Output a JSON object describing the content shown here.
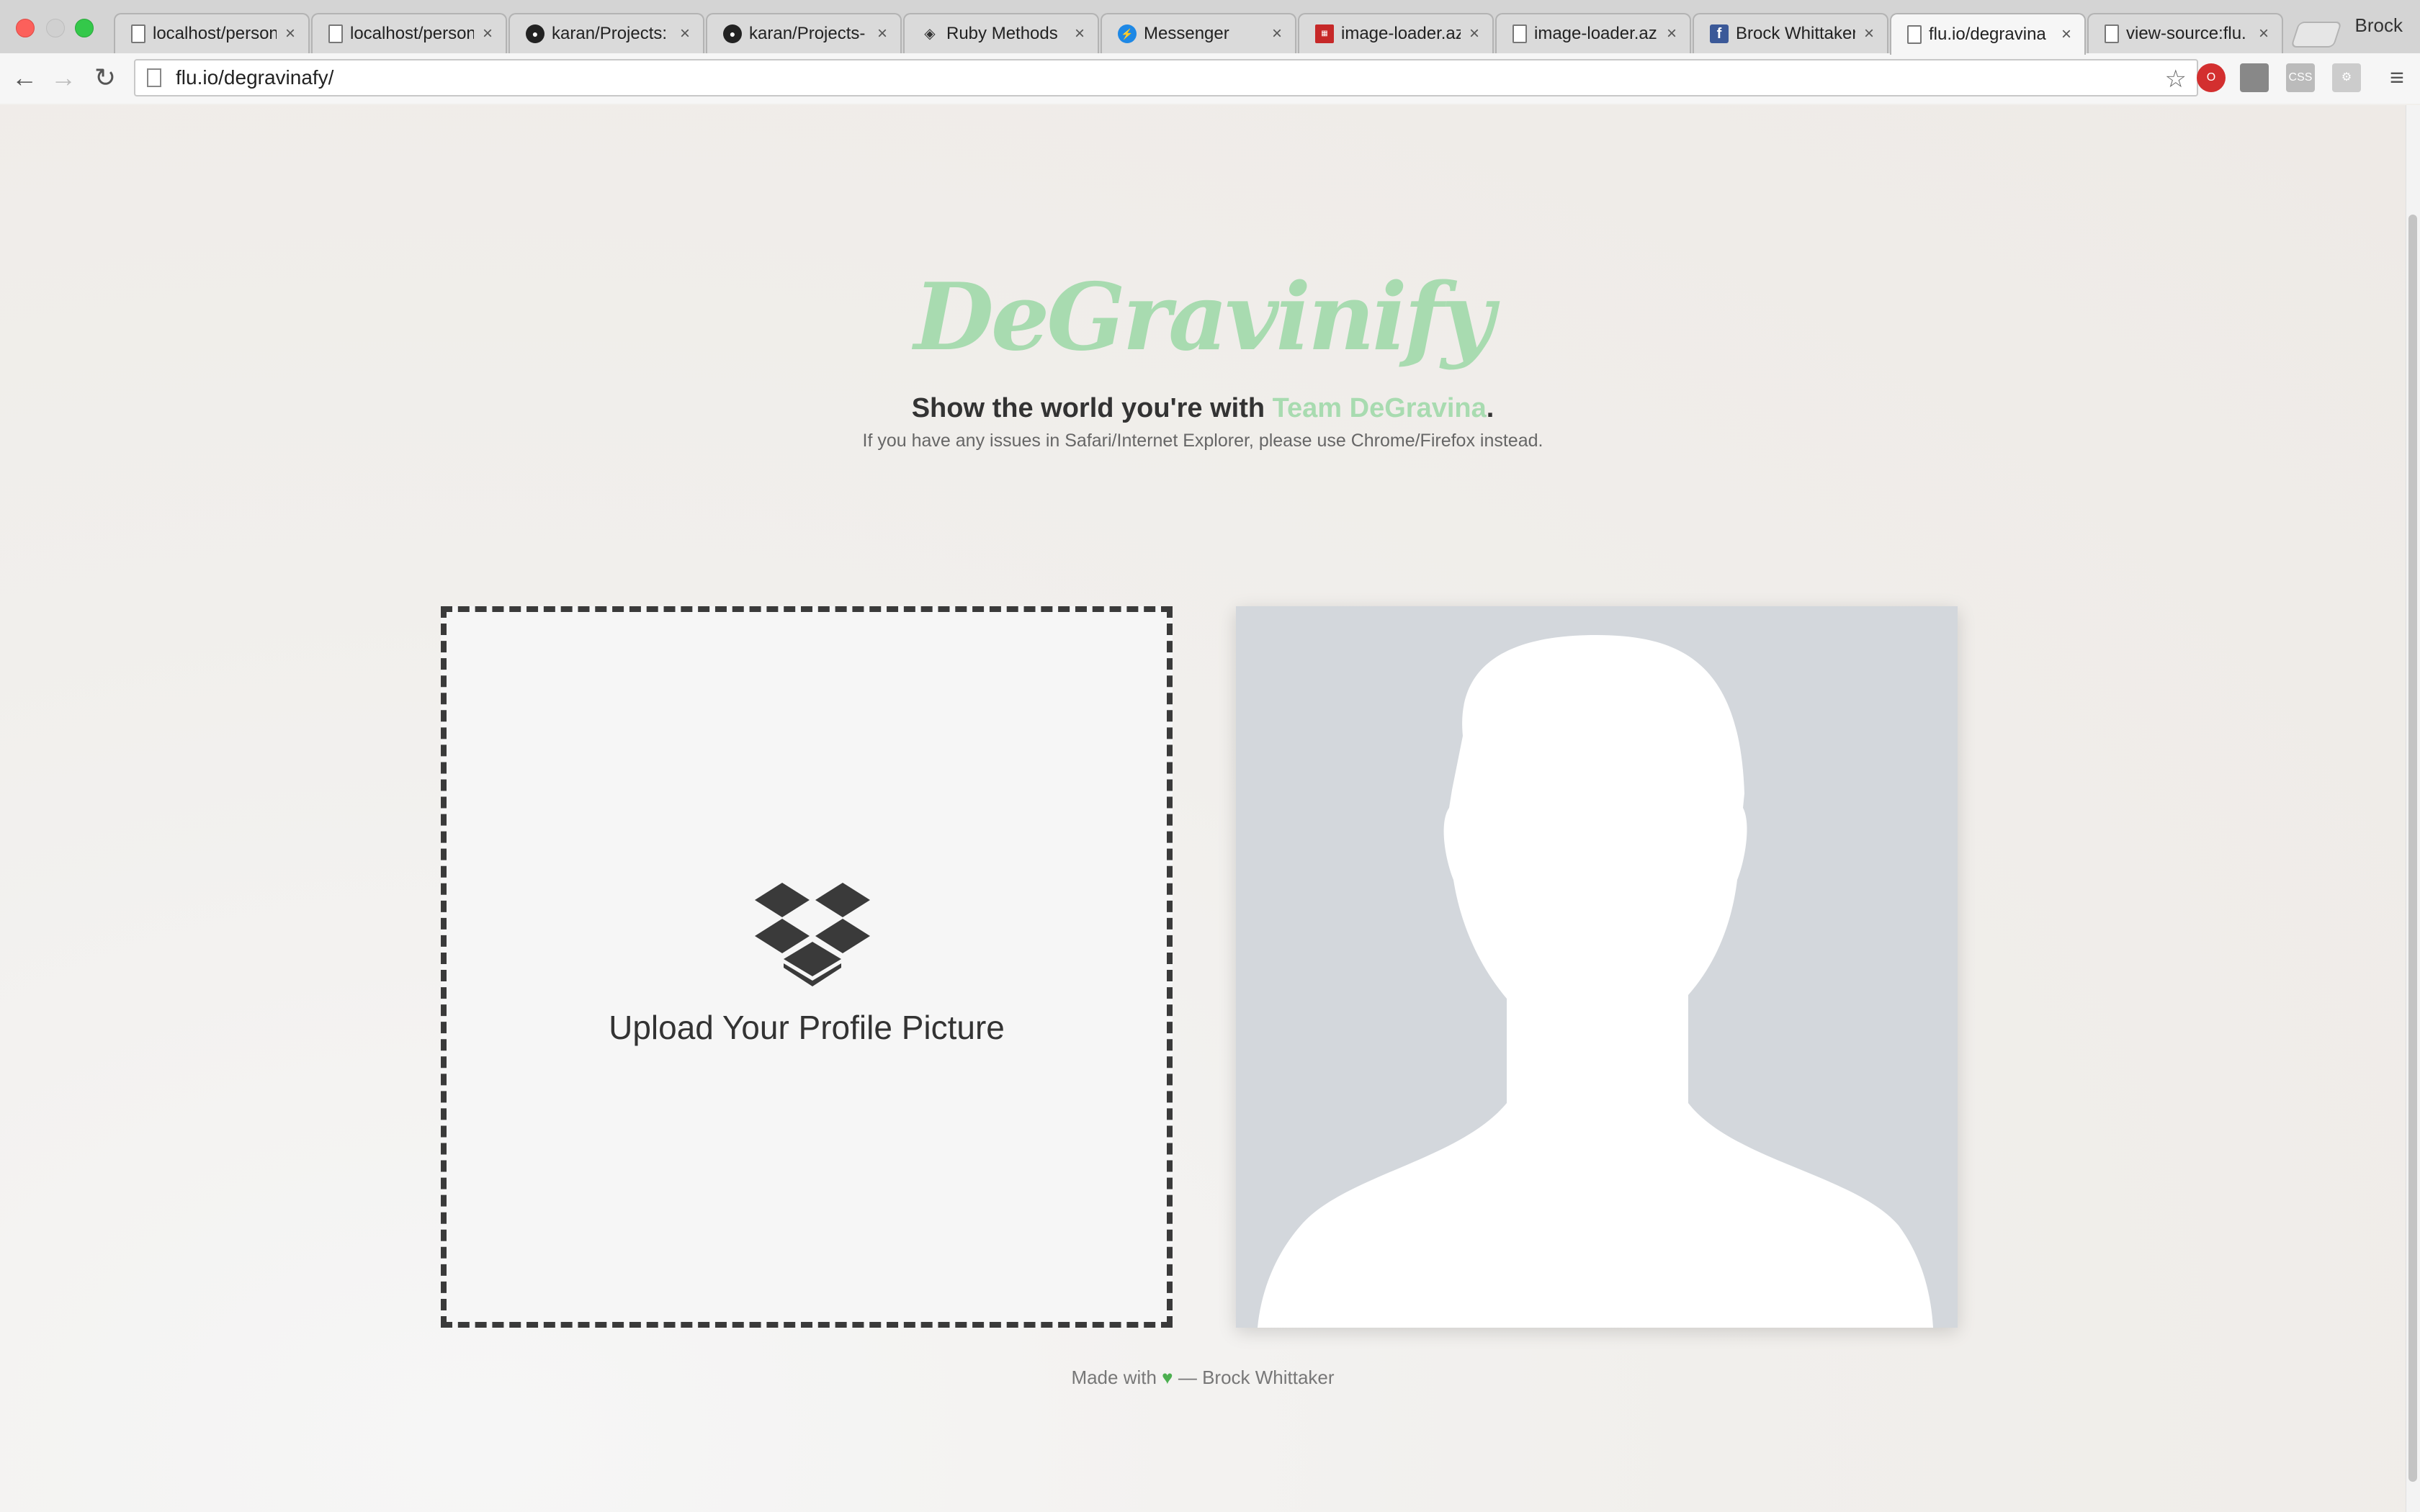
{
  "browser": {
    "tabs": [
      {
        "title": "localhost/person",
        "favicon": "page-icon"
      },
      {
        "title": "localhost/person",
        "favicon": "page-icon"
      },
      {
        "title": "karan/Projects:",
        "favicon": "github-icon"
      },
      {
        "title": "karan/Projects-",
        "favicon": "github-icon"
      },
      {
        "title": "Ruby Methods",
        "favicon": "ruby-icon"
      },
      {
        "title": "Messenger",
        "favicon": "messenger-icon"
      },
      {
        "title": "image-loader.az",
        "favicon": "image-icon"
      },
      {
        "title": "image-loader.az",
        "favicon": "page-icon"
      },
      {
        "title": "Brock Whittaker",
        "favicon": "facebook-icon"
      },
      {
        "title": "flu.io/degravina",
        "favicon": "page-icon",
        "active": true
      },
      {
        "title": "view-source:flu.",
        "favicon": "page-icon"
      }
    ],
    "profile_name": "Brock",
    "url": "flu.io/degravinafy/"
  },
  "page": {
    "logo": "DeGravinify",
    "tagline_prefix": "Show the world you're with ",
    "tagline_accent": "Team DeGravina",
    "tagline_suffix": ".",
    "notice": "If you have any issues in Safari/Internet Explorer, please use Chrome/Firefox instead.",
    "upload_label": "Upload Your Profile Picture",
    "footer_prefix": "Made with",
    "footer_suffix": "— Brock Whittaker"
  },
  "colors": {
    "accent": "#a8dbb0",
    "upload_border": "#3a3a3a",
    "preview_bg": "#d3d7dc"
  }
}
